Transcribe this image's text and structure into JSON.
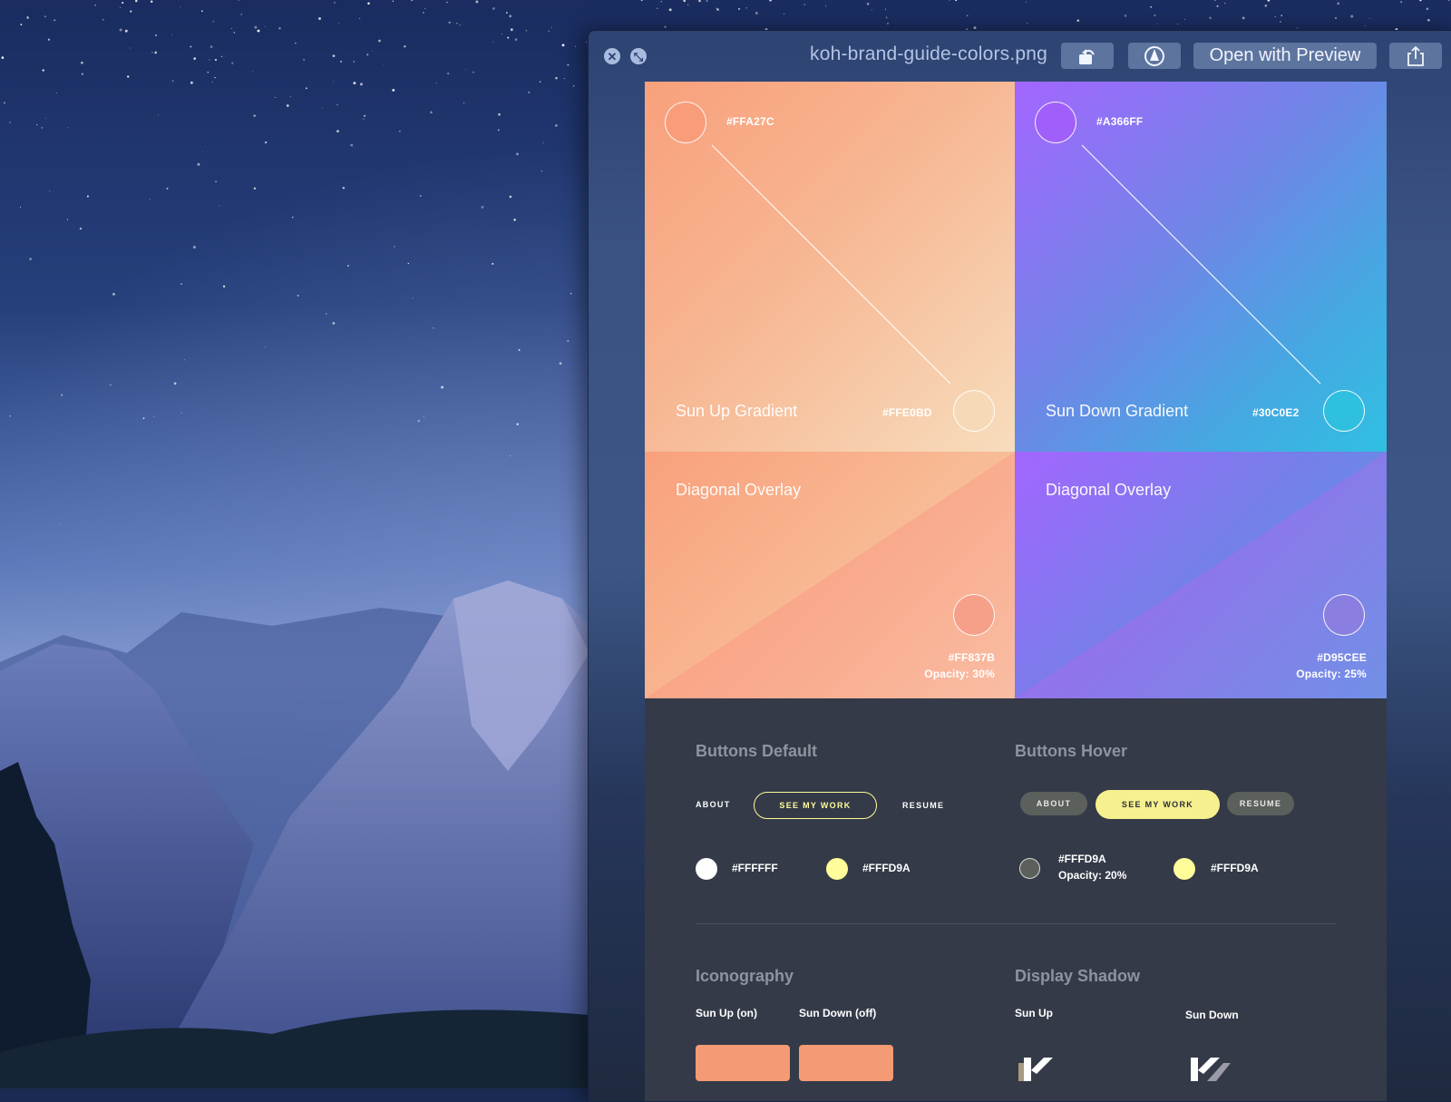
{
  "window": {
    "title": "koh-brand-guide-colors.png",
    "buttons": {
      "close_icon": "close-icon",
      "fullscreen_icon": "fullscreen-icon",
      "rotate_icon": "rotate-left-icon",
      "markup_icon": "markup-pen-icon",
      "open_with": "Open with Preview",
      "share_icon": "share-icon"
    }
  },
  "brand_guide": {
    "gradients": [
      {
        "name": "Sun Up Gradient",
        "start_hex": "#FFA27C",
        "end_hex": "#FFE0BD"
      },
      {
        "name": "Sun Down Gradient",
        "start_hex": "#A366FF",
        "end_hex": "#30C0E2"
      }
    ],
    "overlays": [
      {
        "title": "Diagonal Overlay",
        "hex": "#FF837B",
        "opacity": "Opacity: 30%"
      },
      {
        "title": "Diagonal Overlay",
        "hex": "#D95CEE",
        "opacity": "Opacity: 25%"
      }
    ],
    "buttons_default": {
      "title": "Buttons Default",
      "about": "ABOUT",
      "see_my_work": "SEE MY WORK",
      "resume": "RESUME",
      "swatches": [
        {
          "hex": "#FFFFFF",
          "color": "#FFFFFF"
        },
        {
          "hex": "#FFFD9A",
          "color": "#FFFD9A"
        }
      ]
    },
    "buttons_hover": {
      "title": "Buttons Hover",
      "about": "ABOUT",
      "see_my_work": "SEE MY WORK",
      "resume": "RESUME",
      "swatches": [
        {
          "hex": "#FFFD9A",
          "note": "Opacity: 20%",
          "color": "#5c605c"
        },
        {
          "hex": "#FFFD9A",
          "color": "#FFFD9A"
        }
      ]
    },
    "iconography": {
      "title": "Iconography",
      "labels": [
        "Sun Up (on)",
        "Sun Down (off)"
      ],
      "tile_color": "#F49A75"
    },
    "display_shadow": {
      "title": "Display Shadow",
      "labels": [
        "Sun Up",
        "Sun Down"
      ]
    }
  }
}
